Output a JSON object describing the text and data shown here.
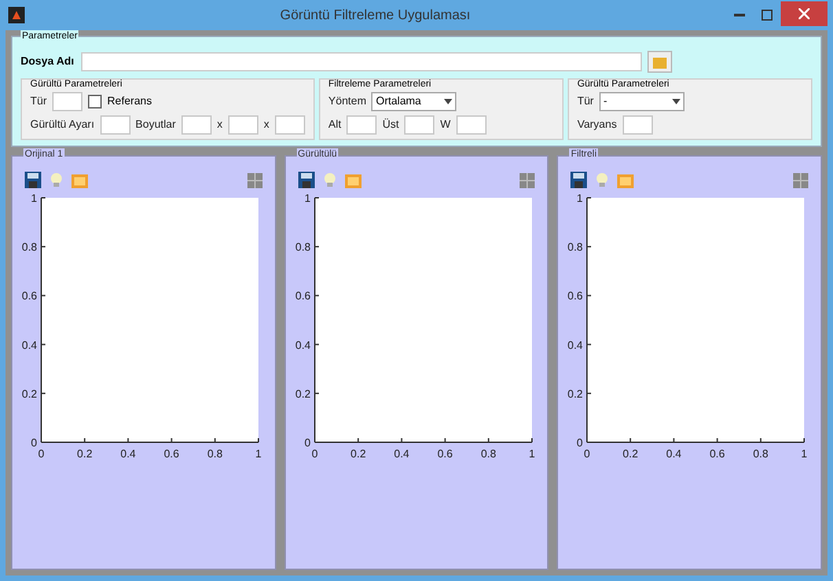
{
  "window": {
    "title": "Görüntü Filtreleme Uygulaması"
  },
  "parameters": {
    "title": "Parametreler",
    "file": {
      "label": "Dosya Adı"
    },
    "groups": [
      {
        "title": "Gürültü Parametreleri",
        "rows": [
          [
            {
              "kind": "label",
              "text": "Tür"
            },
            {
              "kind": "input"
            },
            {
              "kind": "checkbox",
              "text": "Referans",
              "checked": false
            }
          ],
          [
            {
              "kind": "label",
              "text": "Gürültü Ayarı"
            },
            {
              "kind": "input"
            },
            {
              "kind": "label",
              "text": "Boyutlar"
            },
            {
              "kind": "input"
            },
            {
              "kind": "label",
              "text": "x"
            },
            {
              "kind": "input"
            },
            {
              "kind": "label",
              "text": "x"
            },
            {
              "kind": "input"
            }
          ]
        ]
      },
      {
        "title": "Filtreleme Parametreleri",
        "rows": [
          [
            {
              "kind": "label",
              "text": "Yöntem"
            },
            {
              "kind": "select",
              "value": "Ortalama"
            }
          ],
          [
            {
              "kind": "label",
              "text": "Alt"
            },
            {
              "kind": "input"
            },
            {
              "kind": "label",
              "text": "Üst"
            },
            {
              "kind": "input"
            },
            {
              "kind": "label",
              "text": "W"
            },
            {
              "kind": "input"
            }
          ]
        ]
      },
      {
        "title": "Gürültü Parametreleri",
        "rows": [
          [
            {
              "kind": "label",
              "text": "Tür"
            },
            {
              "kind": "select",
              "value": "-"
            }
          ],
          [
            {
              "kind": "label",
              "text": "Varyans"
            },
            {
              "kind": "input"
            }
          ]
        ]
      }
    ]
  },
  "plots": [
    {
      "title": "Orijinal 1",
      "chart_data": {
        "type": "line",
        "xlim": [
          0,
          1
        ],
        "ylim": [
          0,
          1
        ],
        "xticks": [
          {
            "value": 0,
            "label": "0"
          },
          {
            "value": 0.2,
            "label": "0.2"
          },
          {
            "value": 0.4,
            "label": "0.4"
          },
          {
            "value": 0.6,
            "label": "0.6"
          },
          {
            "value": 0.8,
            "label": "0.8"
          },
          {
            "value": 1,
            "label": "1"
          }
        ],
        "yticks": [
          {
            "value": 0,
            "label": "0"
          },
          {
            "value": 0.2,
            "label": "0.2"
          },
          {
            "value": 0.4,
            "label": "0.4"
          },
          {
            "value": 0.6,
            "label": "0.6"
          },
          {
            "value": 0.8,
            "label": "0.8"
          },
          {
            "value": 1,
            "label": "1"
          }
        ]
      }
    },
    {
      "title": "Gürültülü",
      "chart_data": {
        "type": "line",
        "xlim": [
          0,
          1
        ],
        "ylim": [
          0,
          1
        ],
        "xticks": [
          {
            "value": 0,
            "label": "0"
          },
          {
            "value": 0.2,
            "label": "0.2"
          },
          {
            "value": 0.4,
            "label": "0.4"
          },
          {
            "value": 0.6,
            "label": "0.6"
          },
          {
            "value": 0.8,
            "label": "0.8"
          },
          {
            "value": 1,
            "label": "1"
          }
        ],
        "yticks": [
          {
            "value": 0,
            "label": "0"
          },
          {
            "value": 0.2,
            "label": "0.2"
          },
          {
            "value": 0.4,
            "label": "0.4"
          },
          {
            "value": 0.6,
            "label": "0.6"
          },
          {
            "value": 0.8,
            "label": "0.8"
          },
          {
            "value": 1,
            "label": "1"
          }
        ]
      }
    },
    {
      "title": "Filtreli",
      "chart_data": {
        "type": "line",
        "xlim": [
          0,
          1
        ],
        "ylim": [
          0,
          1
        ],
        "xticks": [
          {
            "value": 0,
            "label": "0"
          },
          {
            "value": 0.2,
            "label": "0.2"
          },
          {
            "value": 0.4,
            "label": "0.4"
          },
          {
            "value": 0.6,
            "label": "0.6"
          },
          {
            "value": 0.8,
            "label": "0.8"
          },
          {
            "value": 1,
            "label": "1"
          }
        ],
        "yticks": [
          {
            "value": 0,
            "label": "0"
          },
          {
            "value": 0.2,
            "label": "0.2"
          },
          {
            "value": 0.4,
            "label": "0.4"
          },
          {
            "value": 0.6,
            "label": "0.6"
          },
          {
            "value": 0.8,
            "label": "0.8"
          },
          {
            "value": 1,
            "label": "1"
          }
        ]
      }
    }
  ]
}
